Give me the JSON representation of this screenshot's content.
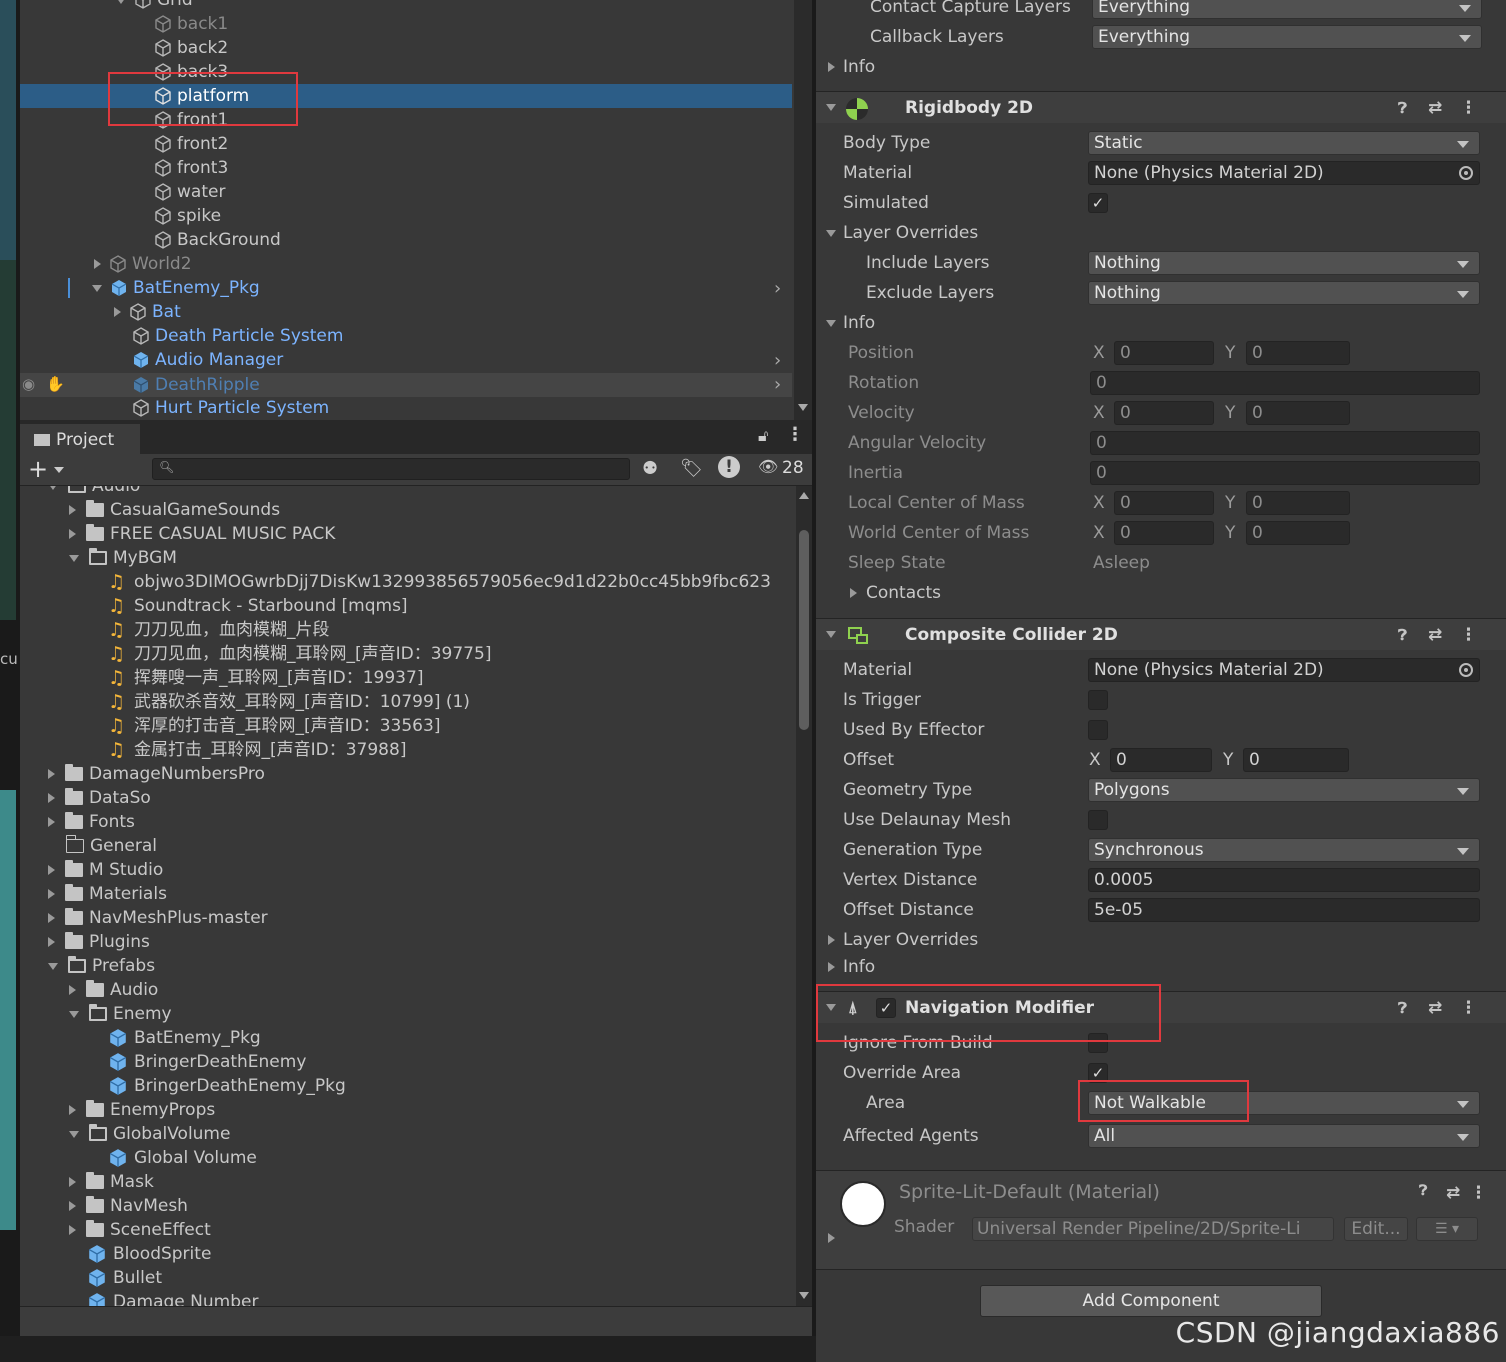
{
  "hierarchy": {
    "grid_label": "Grid",
    "items": [
      {
        "label": "back1"
      },
      {
        "label": "back2"
      },
      {
        "label": "back3"
      },
      {
        "label": "platform"
      },
      {
        "label": "front1"
      },
      {
        "label": "front2"
      },
      {
        "label": "front3"
      },
      {
        "label": "water"
      },
      {
        "label": "spike"
      },
      {
        "label": "BackGround"
      }
    ],
    "world2": "World2",
    "bat_pkg": "BatEnemy_Pkg",
    "bat": "Bat",
    "death_particle": "Death Particle System",
    "audio_manager": "Audio Manager",
    "death_ripple": "DeathRipple",
    "hurt_particle": "Hurt Particle System"
  },
  "project": {
    "tab_label": "Project",
    "hidden_count": "28",
    "rows": [
      {
        "label": "Audio",
        "kind": "folder-open"
      },
      {
        "label": "CasualGameSounds",
        "kind": "folder"
      },
      {
        "label": "FREE CASUAL MUSIC PACK",
        "kind": "folder"
      },
      {
        "label": "MyBGM",
        "kind": "folder-open"
      },
      {
        "label": "objwo3DIMOGwrbDjj7DisKw132993856579056ec9d1d22b0cc45bb9fbc623",
        "kind": "audio"
      },
      {
        "label": "Soundtrack - Starbound [mqms]",
        "kind": "audio"
      },
      {
        "label": "刀刀见血，血肉模糊_片段",
        "kind": "audio"
      },
      {
        "label": "刀刀见血，血肉模糊_耳聆网_[声音ID：39775]",
        "kind": "audio"
      },
      {
        "label": "挥舞嗖一声_耳聆网_[声音ID：19937]",
        "kind": "audio"
      },
      {
        "label": "武器砍杀音效_耳聆网_[声音ID：10799] (1)",
        "kind": "audio"
      },
      {
        "label": "浑厚的打击音_耳聆网_[声音ID：33563]",
        "kind": "audio"
      },
      {
        "label": "金属打击_耳聆网_[声音ID：37988]",
        "kind": "audio"
      },
      {
        "label": "DamageNumbersPro",
        "kind": "folder"
      },
      {
        "label": "DataSo",
        "kind": "folder"
      },
      {
        "label": "Fonts",
        "kind": "folder"
      },
      {
        "label": "General",
        "kind": "folder-empty"
      },
      {
        "label": "M Studio",
        "kind": "folder"
      },
      {
        "label": "Materials",
        "kind": "folder"
      },
      {
        "label": "NavMeshPlus-master",
        "kind": "folder"
      },
      {
        "label": "Plugins",
        "kind": "folder"
      },
      {
        "label": "Prefabs",
        "kind": "folder-open"
      },
      {
        "label": "Audio",
        "kind": "folder"
      },
      {
        "label": "Enemy",
        "kind": "folder-open"
      },
      {
        "label": "BatEnemy_Pkg",
        "kind": "prefab"
      },
      {
        "label": "BringerDeathEnemy",
        "kind": "prefab"
      },
      {
        "label": "BringerDeathEnemy_Pkg",
        "kind": "prefab"
      },
      {
        "label": "EnemyProps",
        "kind": "folder"
      },
      {
        "label": "GlobalVolume",
        "kind": "folder-open"
      },
      {
        "label": "Global Volume",
        "kind": "prefab"
      },
      {
        "label": "Mask",
        "kind": "folder"
      },
      {
        "label": "NavMesh",
        "kind": "folder"
      },
      {
        "label": "SceneEffect",
        "kind": "folder"
      },
      {
        "label": "BloodSprite",
        "kind": "prefab"
      },
      {
        "label": "Bullet",
        "kind": "prefab"
      },
      {
        "label": "Damage Number",
        "kind": "prefab"
      }
    ]
  },
  "inspector": {
    "top": {
      "contact_capture_label": "Contact Capture Layers",
      "contact_capture_value": "Everything",
      "callback_label": "Callback Layers",
      "callback_value": "Everything",
      "info_label": "Info"
    },
    "rigidbody": {
      "title": "Rigidbody 2D",
      "body_type_label": "Body Type",
      "body_type_value": "Static",
      "material_label": "Material",
      "material_value": "None (Physics Material 2D)",
      "simulated_label": "Simulated",
      "simulated_checked": "✓",
      "layer_overrides_label": "Layer Overrides",
      "include_label": "Include Layers",
      "include_value": "Nothing",
      "exclude_label": "Exclude Layers",
      "exclude_value": "Nothing",
      "info_label": "Info",
      "position_label": "Position",
      "rotation_label": "Rotation",
      "velocity_label": "Velocity",
      "angular_velocity_label": "Angular Velocity",
      "inertia_label": "Inertia",
      "local_com_label": "Local Center of Mass",
      "world_com_label": "World Center of Mass",
      "sleep_state_label": "Sleep State",
      "sleep_state_value": "Asleep",
      "contacts_label": "Contacts",
      "x_label": "X",
      "y_label": "Y",
      "zero": "0"
    },
    "composite": {
      "title": "Composite Collider 2D",
      "material_label": "Material",
      "material_value": "None (Physics Material 2D)",
      "is_trigger_label": "Is Trigger",
      "used_by_effector_label": "Used By Effector",
      "offset_label": "Offset",
      "geometry_type_label": "Geometry Type",
      "geometry_type_value": "Polygons",
      "delaunay_label": "Use Delaunay Mesh",
      "generation_type_label": "Generation Type",
      "generation_type_value": "Synchronous",
      "vertex_distance_label": "Vertex Distance",
      "vertex_distance_value": "0.0005",
      "offset_distance_label": "Offset Distance",
      "offset_distance_value": "5e-05",
      "layer_overrides_label": "Layer Overrides",
      "info_label": "Info"
    },
    "navmod": {
      "title": "Navigation Modifier",
      "enabled": "✓",
      "ignore_label": "Ignore From Build",
      "override_label": "Override Area",
      "override_checked": "✓",
      "area_label": "Area",
      "area_value": "Not Walkable",
      "agents_label": "Affected Agents",
      "agents_value": "All"
    },
    "material": {
      "name": "Sprite-Lit-Default (Material)",
      "shader_label": "Shader",
      "shader_value": "Universal Render Pipeline/2D/Sprite-Li",
      "edit_label": "Edit..."
    },
    "add_component": "Add Component"
  },
  "watermark": "CSDN @jiangdaxia886",
  "side_text": "cu"
}
